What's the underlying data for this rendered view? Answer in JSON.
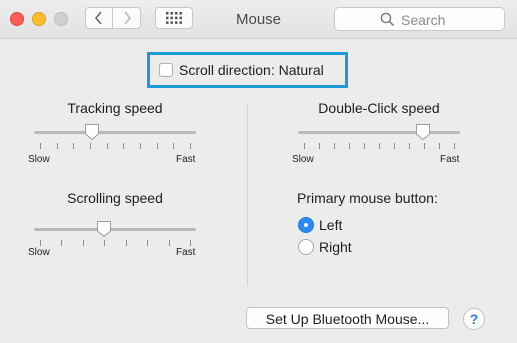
{
  "window": {
    "title": "Mouse"
  },
  "search": {
    "placeholder": "Search"
  },
  "scroll_direction": {
    "label": "Scroll direction: Natural",
    "checked": false
  },
  "tracking": {
    "label": "Tracking speed",
    "min_label": "Slow",
    "max_label": "Fast",
    "level": 0.36,
    "tick_count": 10
  },
  "scrolling": {
    "label": "Scrolling speed",
    "min_label": "Slow",
    "max_label": "Fast",
    "level": 0.43,
    "tick_count": 8
  },
  "double_click": {
    "label": "Double-Click speed",
    "min_label": "Slow",
    "max_label": "Fast",
    "level": 0.77,
    "tick_count": 11
  },
  "primary_button": {
    "label": "Primary mouse button:",
    "options": [
      {
        "label": "Left",
        "selected": true
      },
      {
        "label": "Right",
        "selected": false
      }
    ]
  },
  "bluetooth_button": {
    "label": "Set Up Bluetooth Mouse..."
  },
  "help": {
    "label": "?"
  },
  "colors": {
    "highlight": "#1e9bd7",
    "accent": "#2a8af6"
  }
}
